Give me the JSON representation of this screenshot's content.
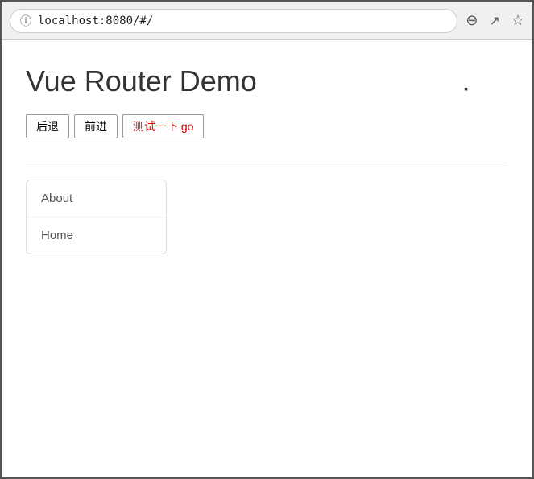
{
  "browser": {
    "address": "localhost:8080/#/",
    "icons": {
      "info": "ⓘ",
      "zoom_out": "🔍",
      "share": "↗",
      "bookmark": "☆"
    }
  },
  "page": {
    "title": "Vue Router Demo",
    "buttons": {
      "back": "后退",
      "forward": "前进",
      "go": "测试一下 go"
    },
    "nav_items": [
      {
        "label": "About"
      },
      {
        "label": "Home"
      }
    ]
  }
}
